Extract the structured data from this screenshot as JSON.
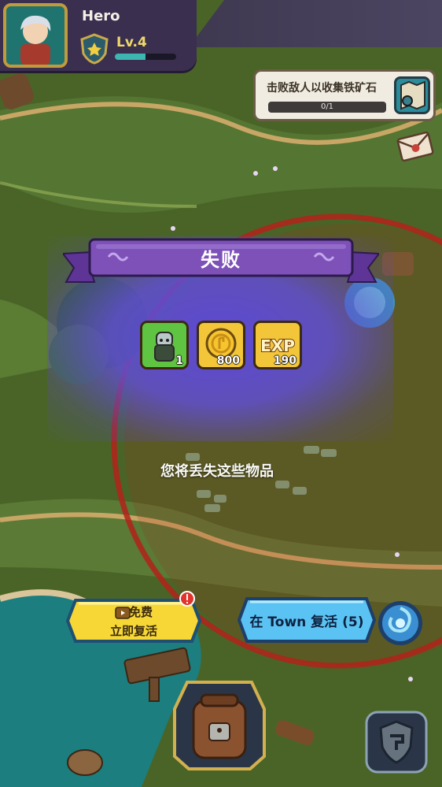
{
  "hud": {
    "hero_name": "Hero",
    "level_label": "Lv.4",
    "xp_fraction": 0.5
  },
  "quest": {
    "text": "击败敌人以收集铁矿石",
    "progress": "0/1",
    "icon": "map-icon"
  },
  "defeat": {
    "title": "失败",
    "items": [
      {
        "icon": "goblin-icon",
        "count": "1",
        "bg": "#5fc441"
      },
      {
        "icon": "coin-icon",
        "count": "800",
        "bg": "#f3c63a"
      },
      {
        "icon": "exp-icon",
        "count": "190",
        "bg": "#f3c63a"
      }
    ],
    "lose_text": "您将丢失这些物品"
  },
  "buttons": {
    "free_line1": "免费",
    "free_line2": "立即复活",
    "town_revive": "在 Town 复活 (5)"
  },
  "colors": {
    "banner": "#7a4fb6",
    "glow": "#5c48de",
    "free_btn": "#f6d736",
    "town_btn": "#5bc3f3"
  }
}
